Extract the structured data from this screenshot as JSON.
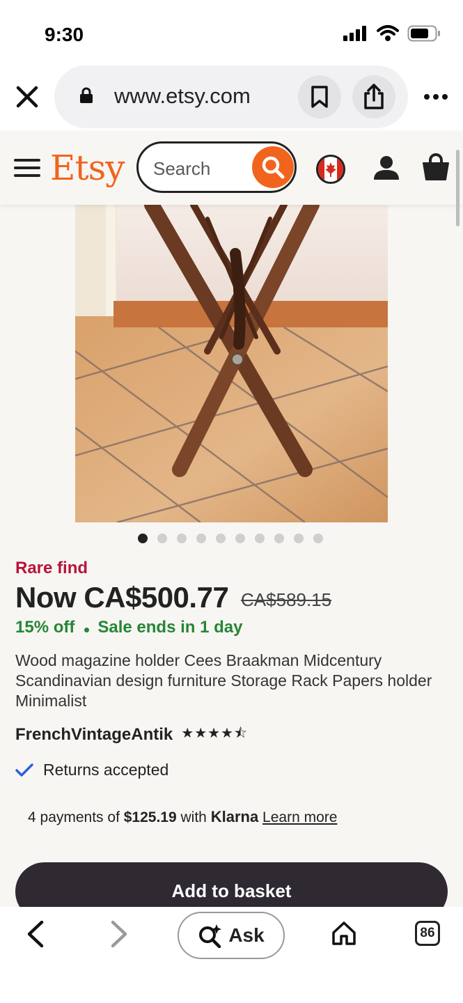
{
  "status_bar": {
    "time": "9:30",
    "icons": [
      "signal-icon",
      "wifi-icon",
      "battery-icon"
    ]
  },
  "browser": {
    "url": "www.etsy.com",
    "icons": [
      "close-icon",
      "lock-icon",
      "bookmark-icon",
      "share-icon",
      "more-icon"
    ]
  },
  "header": {
    "logo": "Etsy",
    "search_placeholder": "Search",
    "icons": [
      "menu-icon",
      "search-icon",
      "canada-flag-icon",
      "account-icon",
      "basket-icon"
    ]
  },
  "product": {
    "gallery": {
      "image_count": 10,
      "active_index": 0
    },
    "badge": "Rare find",
    "price_now": "Now CA$500.77",
    "price_original": "CA$589.15",
    "discount": "15% off",
    "sale_ends": "Sale ends in 1 day",
    "title": "Wood magazine holder Cees Braakman Midcentury Scandinavian design furniture Storage Rack Papers holder Minimalist",
    "shop_name": "FrenchVintageAntik",
    "rating": 4.5,
    "rating_stars": "★★★★⯪",
    "returns": "Returns accepted",
    "klarna": {
      "prefix": "4 payments of",
      "amount": "$125.19",
      "middle": "with",
      "brand": "Klarna",
      "link": "Learn more"
    },
    "add_to_basket": "Add to basket"
  },
  "toolbar": {
    "ask_label": "Ask",
    "tab_count": "86",
    "icons": [
      "back-icon",
      "forward-icon",
      "ask-sparkle-search-icon",
      "home-icon",
      "tabs-icon"
    ]
  },
  "colors": {
    "etsy_orange": "#f1641e",
    "rare_red": "#b8133a",
    "sale_green": "#258635",
    "button_dark": "#2f2932"
  }
}
